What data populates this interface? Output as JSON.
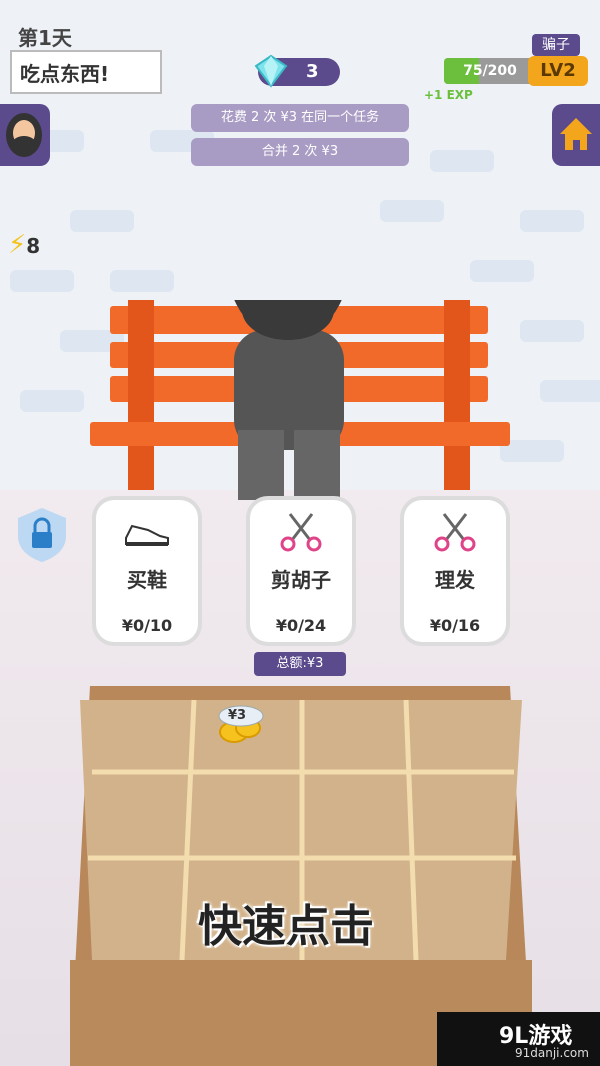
{
  "header": {
    "day": "第1天",
    "task": "吃点东西!",
    "gems": "3",
    "rank": "骗子",
    "xp": "75/200",
    "xp_progress": 0.375,
    "level": "LV2",
    "xp_gain": "+1 EXP"
  },
  "hints": [
    "花费 2 次 ¥3 在同一个任务",
    "合并 2 次 ¥3"
  ],
  "energy": "8",
  "cards": [
    {
      "icon": "shoe-icon",
      "name": "买鞋",
      "price": "¥0/10"
    },
    {
      "icon": "scissors-icon",
      "name": "剪胡子",
      "price": "¥0/24"
    },
    {
      "icon": "scissors-icon",
      "name": "理发",
      "price": "¥0/16"
    }
  ],
  "total": "总额:¥3",
  "coin_label": "¥3",
  "overlay": "快速点击",
  "watermark": {
    "main": "9L游戏",
    "sub": "91danji.com"
  },
  "colors": {
    "panel": "#5b4a8c",
    "accent": "#f3a51c",
    "xp": "#6bbf3c"
  }
}
